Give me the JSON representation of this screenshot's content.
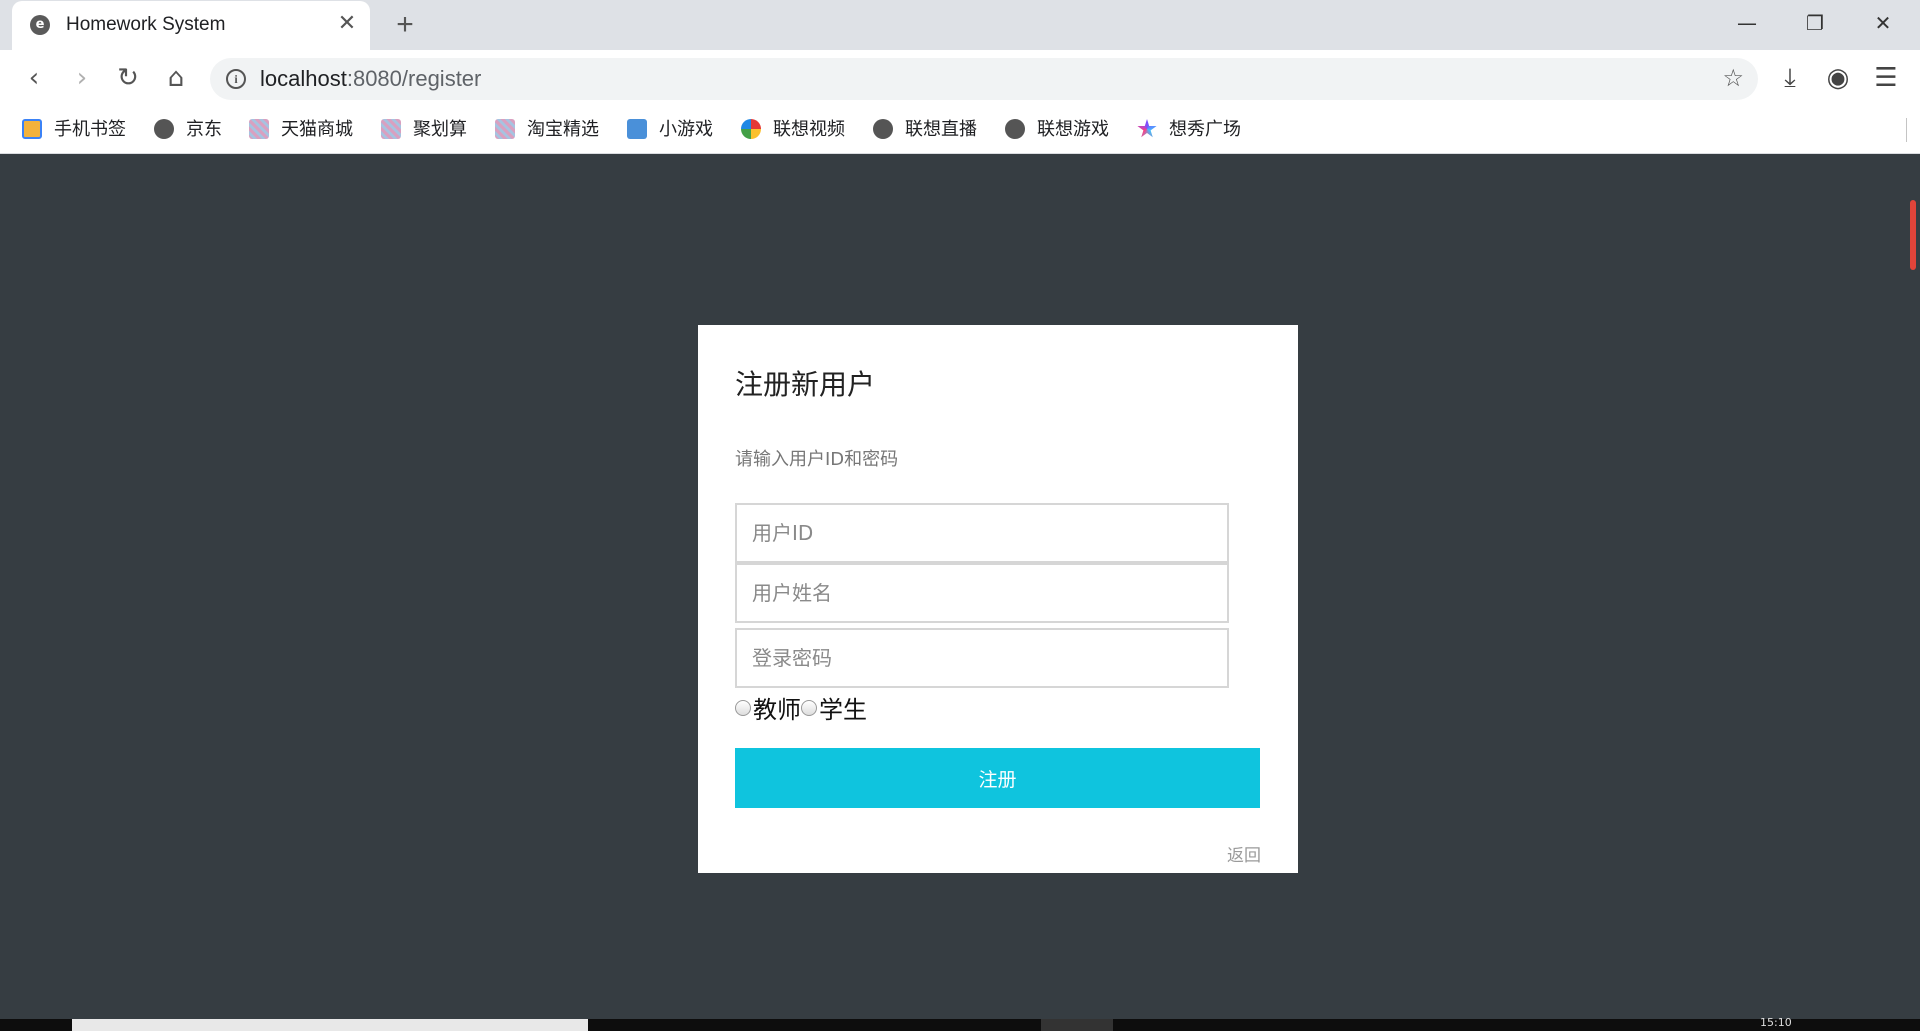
{
  "browser": {
    "tab_title": "Homework System",
    "url_host": "localhost",
    "url_rest": ":8080/register",
    "bookmarks": [
      "手机书签",
      "京东",
      "天猫商城",
      "聚划算",
      "淘宝精选",
      "小游戏",
      "联想视频",
      "联想直播",
      "联想游戏",
      "想秀广场"
    ]
  },
  "form": {
    "title": "注册新用户",
    "subtitle": "请输入用户ID和密码",
    "placeholder_id": "用户ID",
    "placeholder_name": "用户姓名",
    "placeholder_password": "登录密码",
    "role_teacher": "教师",
    "role_student": "学生",
    "submit_label": "注册",
    "back_label": "返回"
  },
  "taskbar": {
    "clock": "15:10"
  },
  "colors": {
    "page_background": "#363d42",
    "submit_button": "#0fc4de",
    "scroll_indicator": "#e0443a"
  }
}
